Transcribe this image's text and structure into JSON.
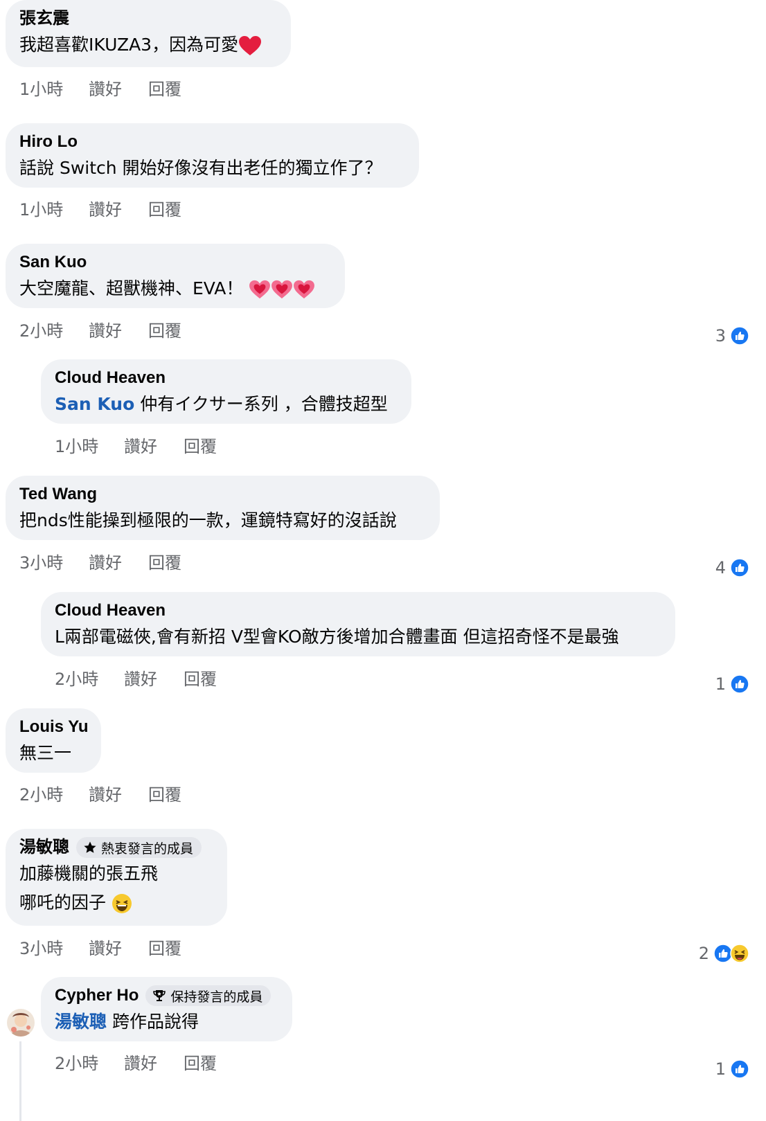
{
  "comments": [
    {
      "author": "張玄震",
      "text": "我超喜歡IKUZA3，因為可愛",
      "time": "1小時",
      "like": "讚好",
      "reply": "回覆"
    },
    {
      "author": "Hiro Lo",
      "text": "話說 Switch 開始好像沒有出老任的獨立作了？",
      "time": "1小時",
      "like": "讚好",
      "reply": "回覆"
    },
    {
      "author": "San Kuo",
      "text": "大空魔龍、超獸機神、EVA！",
      "time": "2小時",
      "like": "讚好",
      "reply": "回覆",
      "reaction_count": "3"
    },
    {
      "author": "Cloud Heaven",
      "mention": "San Kuo",
      "text": "仲有イクサー系列 ，合體技超型",
      "time": "1小時",
      "like": "讚好",
      "reply": "回覆"
    },
    {
      "author": "Ted Wang",
      "text": "把nds性能操到極限的一款，運鏡特寫好的沒話說",
      "time": "3小時",
      "like": "讚好",
      "reply": "回覆",
      "reaction_count": "4"
    },
    {
      "author": "Cloud Heaven",
      "text": "L兩部電磁俠,會有新招 V型會KO敵方後增加合體畫面 但這招奇怪不是最強",
      "time": "2小時",
      "like": "讚好",
      "reply": "回覆",
      "reaction_count": "1"
    },
    {
      "author": "Louis Yu",
      "text": "無三一",
      "time": "2小時",
      "like": "讚好",
      "reply": "回覆"
    },
    {
      "author": "湯敏聰",
      "badge": "熱衷發言的成員",
      "text_line1": "加藤機關的張五飛",
      "text_line2": "哪吒的因子",
      "time": "3小時",
      "like": "讚好",
      "reply": "回覆",
      "reaction_count": "2"
    },
    {
      "author": "Cypher Ho",
      "badge": "保持發言的成員",
      "mention": "湯敏聰",
      "text": "跨作品說得",
      "time": "2小時",
      "like": "讚好",
      "reply": "回覆",
      "reaction_count": "1"
    }
  ],
  "colors": {
    "bubble": "#f0f2f5",
    "meta_text": "#65676b",
    "mention": "#1c5fb5",
    "like_blue": "#1877f2",
    "heart_red": "#e41e3f"
  },
  "icons": {
    "like": "like-icon",
    "haha": "haha-icon",
    "heart": "heart-emoji",
    "sparkling_heart": "sparkling-heart-emoji",
    "star": "star-icon",
    "trophy": "trophy-icon"
  }
}
